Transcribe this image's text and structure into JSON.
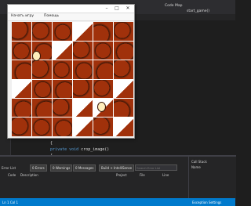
{
  "app_window": {
    "title": "",
    "menu": [
      "Начать игру",
      "Помощь"
    ]
  },
  "ide": {
    "top_right_tabs": [
      "Code Map",
      "start_game()"
    ],
    "code_lines": [
      {
        "kw": "",
        "text": "{"
      },
      {
        "kw": "private void",
        "text": " crop_image()"
      },
      {
        "kw": "",
        "text": "{"
      }
    ],
    "error_list": {
      "title": "Error List",
      "errors_label": "0 Errors",
      "warnings_label": "0 Warnings",
      "messages_label": "0 Messages",
      "build_filter": "Build + IntelliSense",
      "search_placeholder": "Search Error List",
      "columns": [
        "Code",
        "Description",
        "Project",
        "File",
        "Line"
      ]
    },
    "call_stack_title": "Call Stack",
    "call_stack_col": "Name",
    "status_left": "Ln 1 Col 1",
    "status_right": "Exception Settings"
  },
  "puzzle": {
    "rows": 6,
    "cols": 6,
    "colors": {
      "brown": "#a0310b",
      "dark": "#3a1608",
      "white": "#ffffff",
      "eye": "#ffeebb"
    }
  }
}
